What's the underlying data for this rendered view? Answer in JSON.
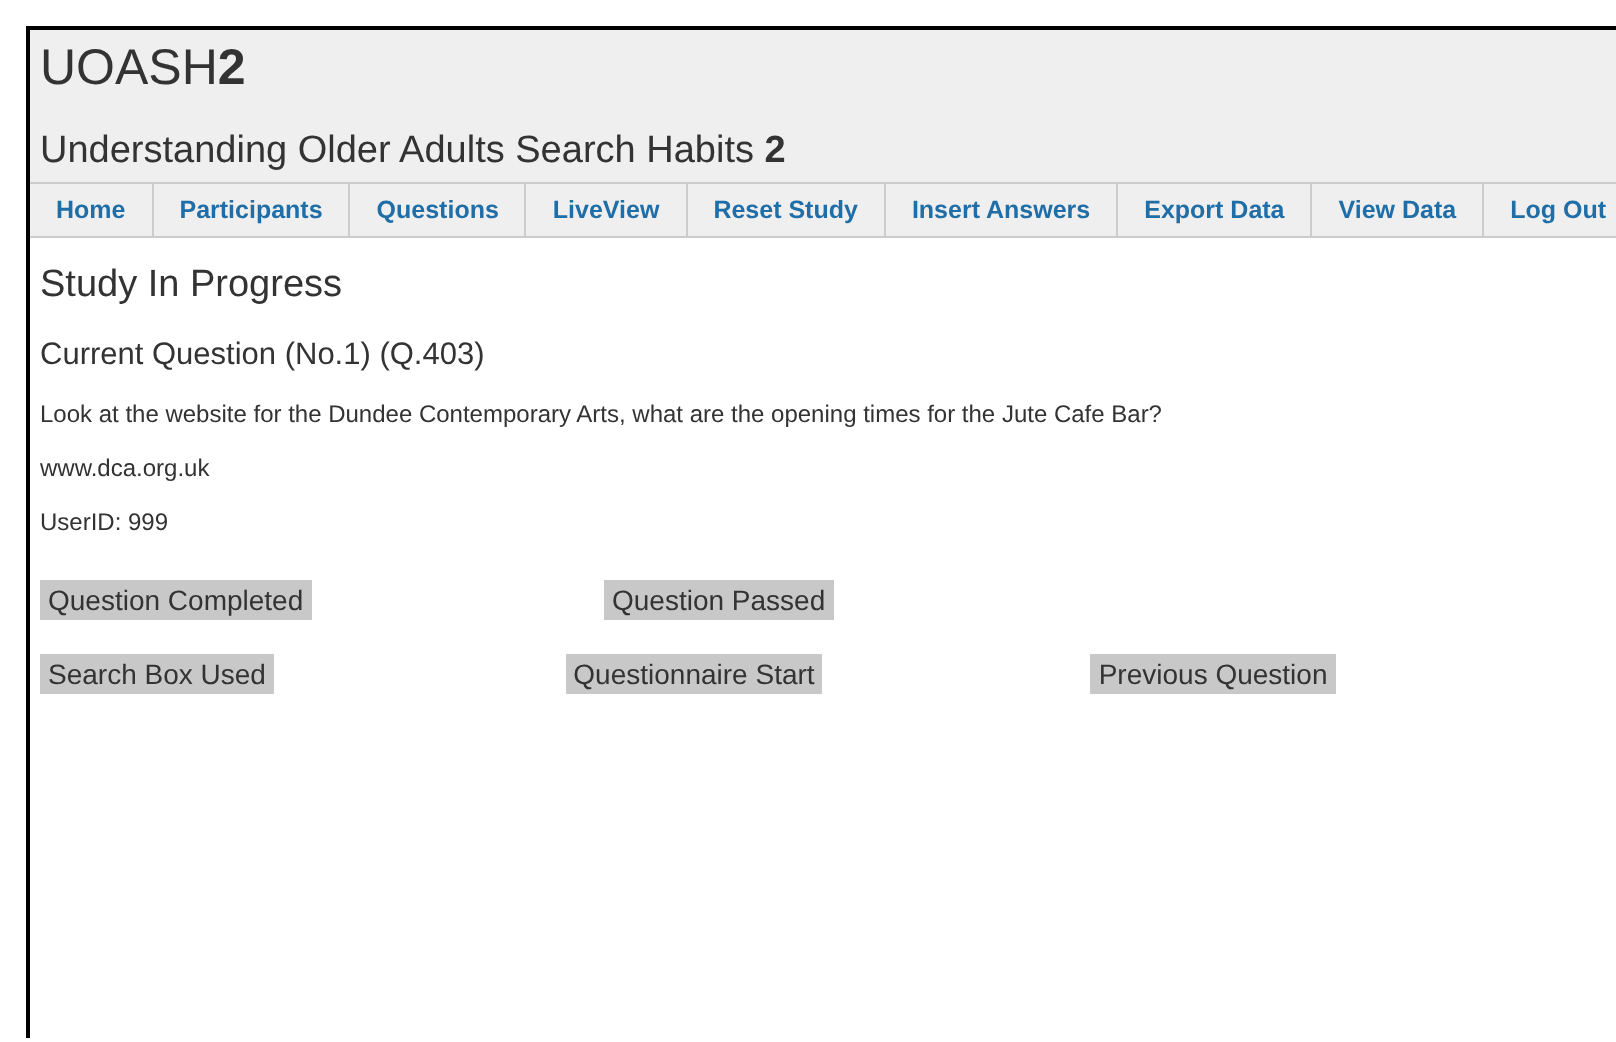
{
  "header": {
    "logo": "UOASH**2**",
    "subtitle": "Understanding Older Adults Search Habits **2**"
  },
  "nav": [
    {
      "label": "Home"
    },
    {
      "label": "Participants"
    },
    {
      "label": "Questions"
    },
    {
      "label": "LiveView"
    },
    {
      "label": "Reset Study"
    },
    {
      "label": "Insert Answers"
    },
    {
      "label": "Export Data"
    },
    {
      "label": "View Data"
    },
    {
      "label": "Log Out"
    }
  ],
  "content": {
    "heading": "Study In Progress",
    "current_question": "Current Question (No.1) (Q.403)",
    "question_text": "Look at the website for the Dundee Contemporary Arts, what are the opening times for the Jute Cafe Bar?",
    "website": "www.dca.org.uk",
    "user_id": "UserID: 999"
  },
  "button_rows": [
    [
      "Question Completed",
      "Question Passed"
    ],
    [
      "Search Box Used",
      "Questionnaire Start",
      "Previous Question"
    ]
  ]
}
